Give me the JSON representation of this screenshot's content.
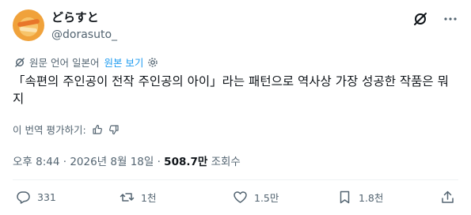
{
  "user": {
    "display_name": "どらすと",
    "handle": "@dorasuto_"
  },
  "header_icons": [
    "grok-icon",
    "more-icon"
  ],
  "translation": {
    "label": "원문 언어 일본어",
    "show_original": "원본 보기"
  },
  "tweet": {
    "text": "「속편의 주인공이 전작 주인공의 아이」라는 패턴으로 역사상 가장 성공한 작품은 뭐지"
  },
  "rate_translation": {
    "label": "이 번역 평가하기:"
  },
  "meta": {
    "time": "오후 8:44",
    "sep1": " · ",
    "date": "2026년 8월 18일",
    "sep2": " · ",
    "views": "508.7만",
    "views_label": " 조회수"
  },
  "actions": {
    "replies": "331",
    "reposts": "1천",
    "likes": "1.5만",
    "bookmarks": "1.8천"
  },
  "colors": {
    "accent": "#1d9bf0",
    "secondary_text": "#536471",
    "primary_text": "#0f1419"
  }
}
